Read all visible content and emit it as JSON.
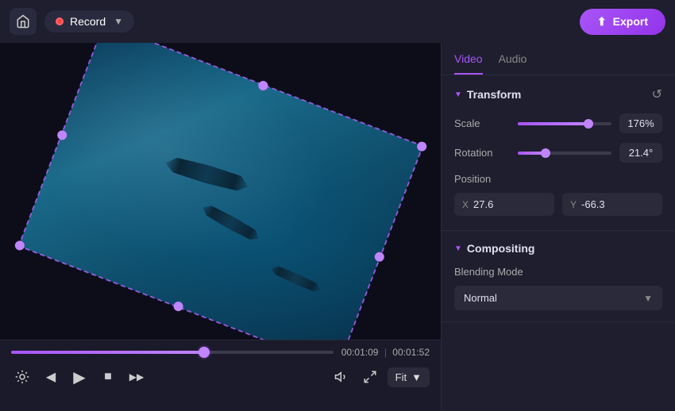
{
  "topbar": {
    "home_icon": "🏠",
    "record_label": "Record",
    "export_label": "Export",
    "export_icon": "⬆"
  },
  "video": {
    "current_time": "00:01:09",
    "total_time": "00:01:52",
    "progress_percent": 60,
    "fit_label": "Fit"
  },
  "controls": {
    "screenshot_icon": "📷",
    "rewind_icon": "◀",
    "play_icon": "▶",
    "stop_icon": "■",
    "forward_icon": "▶▶",
    "volume_icon": "🔊",
    "fullscreen_icon": "⤢"
  },
  "panel": {
    "tab_video": "Video",
    "tab_audio": "Audio",
    "transform_title": "Transform",
    "scale_label": "Scale",
    "scale_value": "176%",
    "scale_percent": 75,
    "rotation_label": "Rotation",
    "rotation_value": "21.4°",
    "rotation_percent": 30,
    "position_label": "Position",
    "pos_x_label": "X",
    "pos_x_value": "27.6",
    "pos_y_label": "Y",
    "pos_y_value": "-66.3",
    "compositing_title": "Compositing",
    "blending_mode_label": "Blending Mode",
    "blending_mode_value": "Normal"
  }
}
